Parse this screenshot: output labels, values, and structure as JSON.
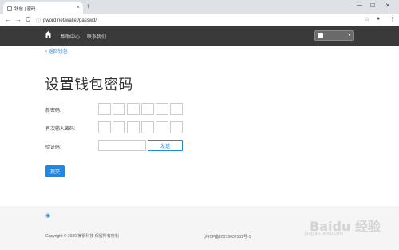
{
  "browser": {
    "tab_title": "钱包 | 密码",
    "tab_close": "×",
    "new_tab": "+",
    "win_min": "—",
    "win_max": "☐",
    "win_close": "✕",
    "back": "←",
    "forward": "→",
    "reload": "C",
    "url": "pword.net/wallet/passwd/",
    "lock": "ⓘ",
    "star": "☆",
    "profile": "●",
    "menu": "⋮"
  },
  "site": {
    "home_icon": "house-icon",
    "nav": [
      "帮助中心",
      "联系我们"
    ],
    "user_caret": "▾"
  },
  "page": {
    "back_link": "返回钱包",
    "back_chev": "‹",
    "title": "设置钱包密码",
    "new_password_label": "新密码:",
    "confirm_password_label": "再次输入密码:",
    "code_label": "验证码:",
    "send_button": "发送",
    "submit_button": "提交"
  },
  "footer": {
    "globe": "◉",
    "copyright": "Copyright © 2020 微钢科技 保留所有权利",
    "icp": "沪ICP备20210032531号-1"
  },
  "watermark": {
    "logo": "Baidu 经验",
    "url": "jingyan.baidu.com"
  }
}
